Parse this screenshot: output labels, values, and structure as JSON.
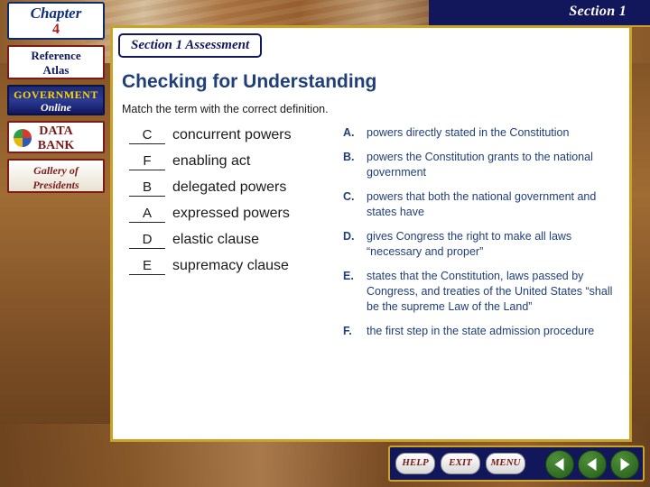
{
  "chapter_tab": {
    "label": "Chapter",
    "number": "4"
  },
  "section_banner": {
    "label": "Section 1"
  },
  "sidebar": {
    "items": [
      {
        "line1": "Reference",
        "line2": "Atlas",
        "name": "reference-atlas"
      },
      {
        "line1": "GOVERNMENT",
        "line2": "Online",
        "name": "government-online"
      },
      {
        "line1": "DATA",
        "line2": "BANK",
        "name": "data-bank"
      },
      {
        "line1": "Gallery of",
        "line2": "Presidents",
        "name": "gallery-of-presidents"
      }
    ]
  },
  "content": {
    "assessment_tab": "Section 1 Assessment",
    "title": "Checking for Understanding",
    "instructions": "Match the term with the correct definition.",
    "terms": [
      {
        "answer": "C",
        "text": "concurrent powers"
      },
      {
        "answer": "F",
        "text": "enabling act"
      },
      {
        "answer": "B",
        "text": "delegated powers"
      },
      {
        "answer": "A",
        "text": "expressed powers"
      },
      {
        "answer": "D",
        "text": "elastic clause"
      },
      {
        "answer": "E",
        "text": "supremacy clause"
      }
    ],
    "definitions": [
      {
        "letter": "A.",
        "text": "powers directly stated in the Constitution"
      },
      {
        "letter": "B.",
        "text": "powers the Constitution grants to the national government"
      },
      {
        "letter": "C.",
        "text": "powers that both the national government and states have"
      },
      {
        "letter": "D.",
        "text": "gives Congress the right to make all laws “necessary and proper”"
      },
      {
        "letter": "E.",
        "text": "states that the Constitution, laws passed by Congress, and treaties of the United States “shall be the supreme Law of the Land”"
      },
      {
        "letter": "F.",
        "text": "the first step in the state admission procedure"
      }
    ]
  },
  "navbar": {
    "buttons": [
      {
        "label": "HELP",
        "name": "help-button"
      },
      {
        "label": "EXIT",
        "name": "exit-button"
      },
      {
        "label": "MENU",
        "name": "menu-button"
      }
    ],
    "arrows": [
      {
        "name": "previous-arrow-button",
        "direction": "left"
      },
      {
        "name": "back-arrow-button",
        "direction": "left"
      },
      {
        "name": "next-arrow-button",
        "direction": "right"
      }
    ]
  },
  "colors": {
    "navy": "#12175c",
    "gold": "#c9a227",
    "brick": "#7c1a1a",
    "title_blue": "#1f3f7a"
  }
}
